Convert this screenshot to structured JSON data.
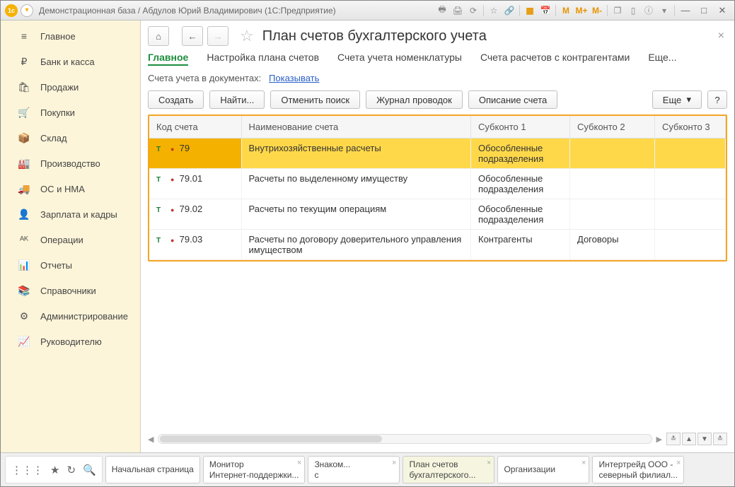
{
  "titlebar": {
    "title": "Демонстрационная база / Абдулов Юрий Владимирович (1С:Предприятие)"
  },
  "sidebar": {
    "items": [
      {
        "icon": "≡",
        "label": "Главное"
      },
      {
        "icon": "₽",
        "label": "Банк и касса"
      },
      {
        "icon": "🛍",
        "label": "Продажи"
      },
      {
        "icon": "🛒",
        "label": "Покупки"
      },
      {
        "icon": "📦",
        "label": "Склад"
      },
      {
        "icon": "🏭",
        "label": "Производство"
      },
      {
        "icon": "🚚",
        "label": "ОС и НМА"
      },
      {
        "icon": "👤",
        "label": "Зарплата и кадры"
      },
      {
        "icon": "ᴬᴷ",
        "label": "Операции"
      },
      {
        "icon": "📊",
        "label": "Отчеты"
      },
      {
        "icon": "📚",
        "label": "Справочники"
      },
      {
        "icon": "⚙",
        "label": "Администрирование"
      },
      {
        "icon": "📈",
        "label": "Руководителю"
      }
    ]
  },
  "page": {
    "title": "План счетов бухгалтерского учета",
    "tabs": [
      "Главное",
      "Настройка плана счетов",
      "Счета учета номенклатуры",
      "Счета расчетов с контрагентами",
      "Еще..."
    ],
    "sublabel": "Счета учета в документах:",
    "sublink": "Показывать",
    "toolbar": {
      "create": "Создать",
      "find": "Найти...",
      "cancel_find": "Отменить поиск",
      "journal": "Журнал проводок",
      "desc": "Описание счета",
      "more": "Еще",
      "help": "?"
    }
  },
  "table": {
    "headers": [
      "Код счета",
      "Наименование счета",
      "Субконто 1",
      "Субконто 2",
      "Субконто 3"
    ],
    "rows": [
      {
        "code": "79",
        "name": "Внутрихозяйственные расчеты",
        "s1": "Обособленные подразделения",
        "s2": "",
        "s3": "",
        "selected": true
      },
      {
        "code": "79.01",
        "name": "Расчеты по выделенному имуществу",
        "s1": "Обособленные подразделения",
        "s2": "",
        "s3": ""
      },
      {
        "code": "79.02",
        "name": "Расчеты по текущим операциям",
        "s1": "Обособленные подразделения",
        "s2": "",
        "s3": ""
      },
      {
        "code": "79.03",
        "name": "Расчеты по договору доверительного управления имуществом",
        "s1": "Контрагенты",
        "s2": "Договоры",
        "s3": ""
      }
    ]
  },
  "footer": {
    "tabs": [
      {
        "line1": "Начальная страница",
        "line2": ""
      },
      {
        "line1": "Монитор",
        "line2": "Интернет-поддержки..."
      },
      {
        "line1": "Знаком...",
        "line2": "с"
      },
      {
        "line1": "План счетов",
        "line2": "бухгалтерского...",
        "active": true
      },
      {
        "line1": "Организации",
        "line2": ""
      },
      {
        "line1": "Интертрейд ООО -",
        "line2": "северный филиал..."
      }
    ]
  }
}
